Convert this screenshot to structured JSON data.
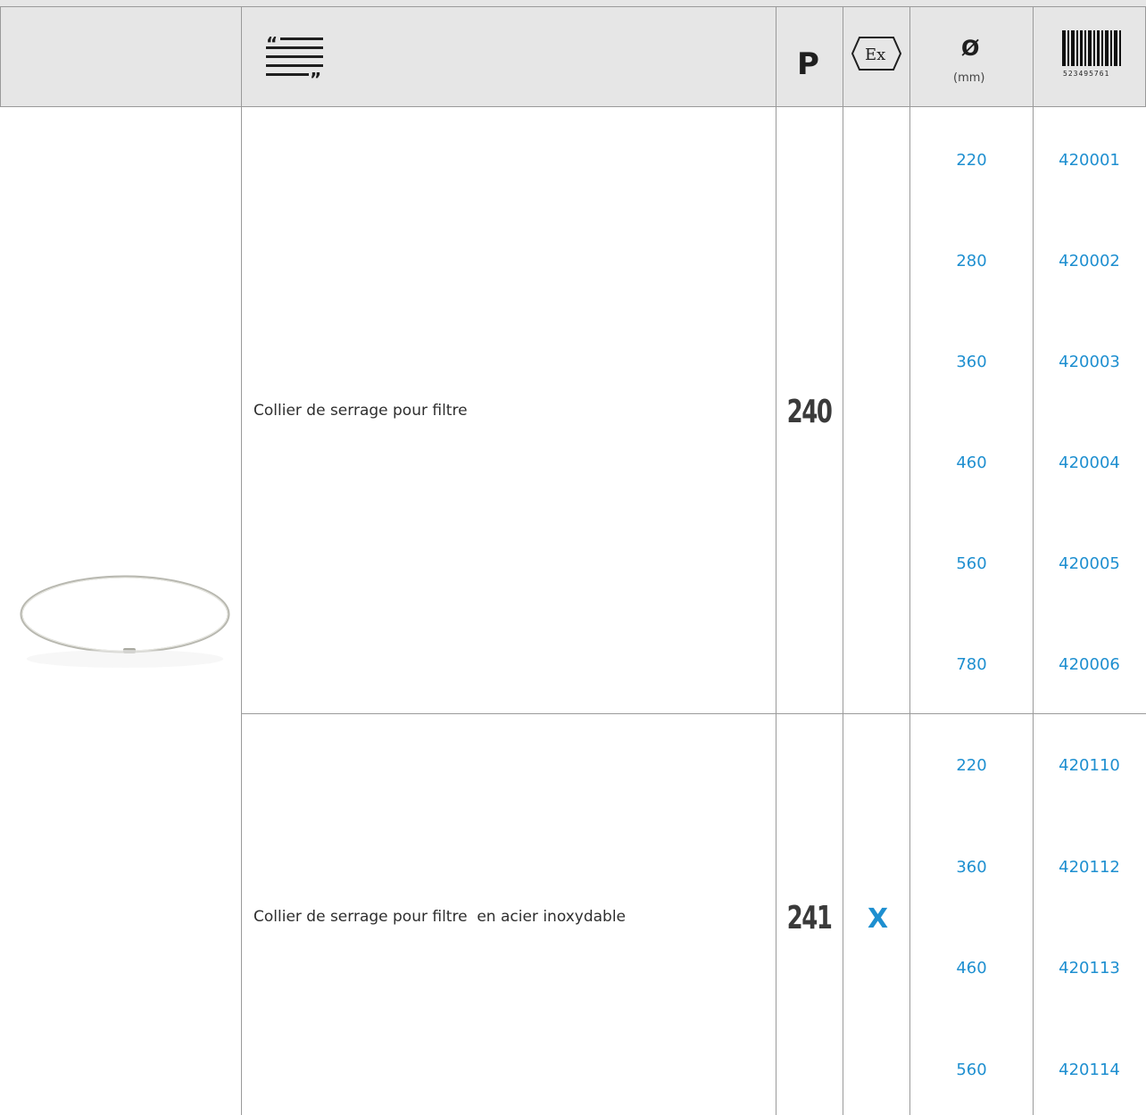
{
  "header": {
    "description_icon": "quote-text-icon",
    "p_label": "P",
    "ex_icon": "atex-ex-icon",
    "ex_text": "Ex",
    "diameter_symbol": "Ø",
    "diameter_unit": "(mm)",
    "barcode_icon": "barcode-icon",
    "barcode_digits": "523495761"
  },
  "product_image": "clamp-ring-image",
  "rows": [
    {
      "description": "Collier de serrage pour filtre",
      "p": "240",
      "ex": "",
      "sizes": [
        {
          "diameter": "220",
          "code": "420001"
        },
        {
          "diameter": "280",
          "code": "420002"
        },
        {
          "diameter": "360",
          "code": "420003"
        },
        {
          "diameter": "460",
          "code": "420004"
        },
        {
          "diameter": "560",
          "code": "420005"
        },
        {
          "diameter": "780",
          "code": "420006"
        }
      ]
    },
    {
      "description": "Collier de serrage pour filtre  en acier inoxydable",
      "p": "241",
      "ex": "X",
      "sizes": [
        {
          "diameter": "220",
          "code": "420110"
        },
        {
          "diameter": "360",
          "code": "420112"
        },
        {
          "diameter": "460",
          "code": "420113"
        },
        {
          "diameter": "560",
          "code": "420114"
        }
      ]
    }
  ],
  "colors": {
    "header_bg": "#e6e6e6",
    "accent_blue": "#1e8fd0",
    "grid_line": "#9a9a9a"
  }
}
